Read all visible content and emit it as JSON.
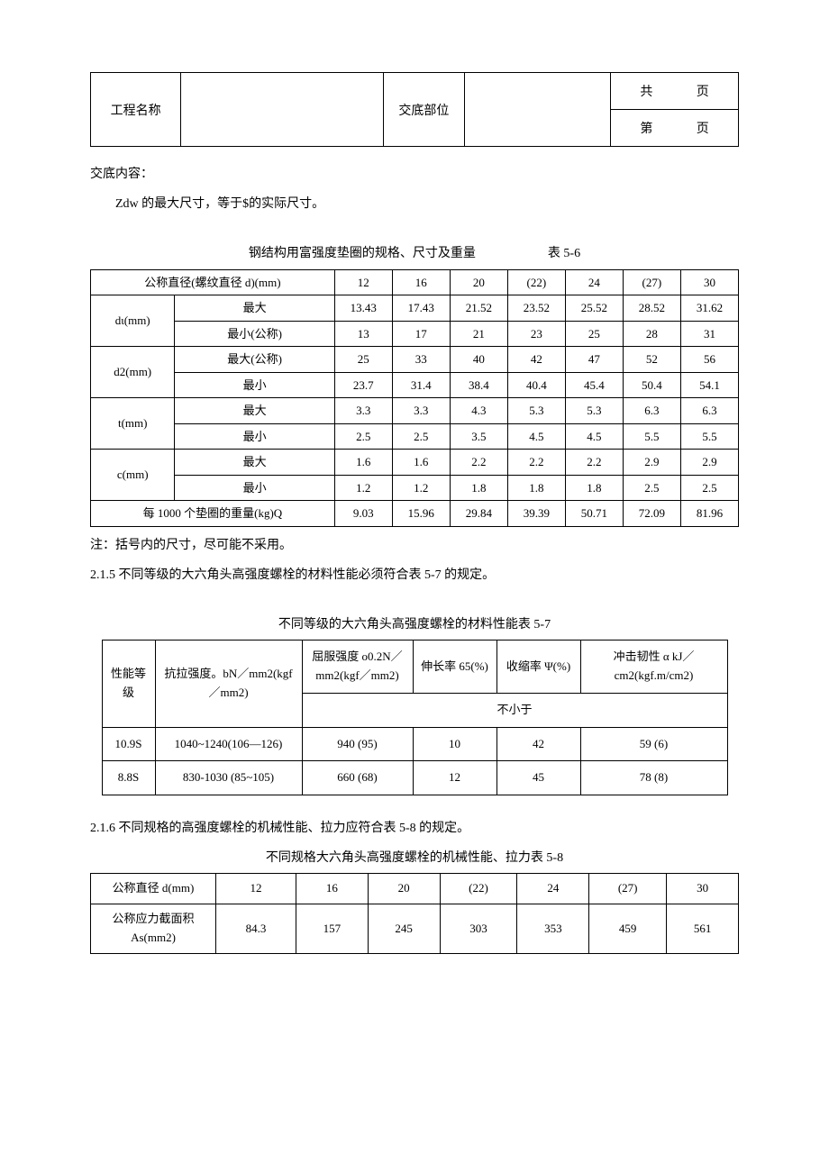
{
  "header": {
    "project_label": "工程名称",
    "part_label": "交底部位",
    "total_lbl_a": "共",
    "total_lbl_b": "页",
    "page_lbl_a": "第",
    "page_lbl_b": "页"
  },
  "content_label": "交底内容：",
  "zdw_line": "Zdw 的最大尺寸，等于$的实际尺寸。",
  "t56_title_left": "钢结构用富强度垫圈的规格、尺寸及重量",
  "t56_title_right": "表 5-6",
  "t56": {
    "h1": "公称直径(螺纹直径 d)(mm)",
    "cols": [
      "12",
      "16",
      "20",
      "(22)",
      "24",
      "(27)",
      "30"
    ],
    "rows": [
      {
        "lab": "dι(mm)",
        "sub1": "最大",
        "v1": [
          "13.43",
          "17.43",
          "21.52",
          "23.52",
          "25.52",
          "28.52",
          "31.62"
        ],
        "sub2": "最小(公称)",
        "v2": [
          "13",
          "17",
          "21",
          "23",
          "25",
          "28",
          "31"
        ]
      },
      {
        "lab": "d2(mm)",
        "sub1": "最大(公称)",
        "v1": [
          "25",
          "33",
          "40",
          "42",
          "47",
          "52",
          "56"
        ],
        "sub2": "最小",
        "v2": [
          "23.7",
          "31.4",
          "38.4",
          "40.4",
          "45.4",
          "50.4",
          "54.1"
        ]
      },
      {
        "lab": "t(mm)",
        "sub1": "最大",
        "v1": [
          "3.3",
          "3.3",
          "4.3",
          "5.3",
          "5.3",
          "6.3",
          "6.3"
        ],
        "sub2": "最小",
        "v2": [
          "2.5",
          "2.5",
          "3.5",
          "4.5",
          "4.5",
          "5.5",
          "5.5"
        ]
      },
      {
        "lab": "c(mm)",
        "sub1": "最大",
        "v1": [
          "1.6",
          "1.6",
          "2.2",
          "2.2",
          "2.2",
          "2.9",
          "2.9"
        ],
        "sub2": "最小",
        "v2": [
          "1.2",
          "1.2",
          "1.8",
          "1.8",
          "1.8",
          "2.5",
          "2.5"
        ]
      }
    ],
    "weight_lab": "每 1000 个垫圈的重量(kg)Q",
    "weight": [
      "9.03",
      "15.96",
      "29.84",
      "39.39",
      "50.71",
      "72.09",
      "81.96"
    ]
  },
  "note_bracket": "注：括号内的尺寸，尽可能不采用。",
  "clause_215": "2.1.5 不同等级的大六角头高强度螺栓的材料性能必须符合表 5-7 的规定。",
  "t57_title": "不同等级的大六角头高强度螺栓的材料性能表 5-7",
  "t57": {
    "h1": "性能等级",
    "h2": "抗拉强度。bN／mm2(kgf／mm2)",
    "h3": "屈服强度 o0.2N／mm2(kgf／mm2)",
    "h4": "伸长率 65(%)",
    "h5": "收缩率 Ψ(%)",
    "h6": "冲击韧性 α kJ／cm2(kgf.m/cm2)",
    "not_less": "不小于",
    "rows": [
      {
        "grade": "10.9S",
        "tensile": "1040~1240(106—126)",
        "yield": "940 (95)",
        "elong": "10",
        "shrink": "42",
        "impact": "59 (6)"
      },
      {
        "grade": "8.8S",
        "tensile": "830-1030 (85~105)",
        "yield": "660 (68)",
        "elong": "12",
        "shrink": "45",
        "impact": "78 (8)"
      }
    ]
  },
  "clause_216": "2.1.6 不同规格的高强度螺栓的机械性能、拉力应符合表 5-8 的规定。",
  "t58_title": "不同规格大六角头高强度螺栓的机械性能、拉力表 5-8",
  "t58": {
    "h1": "公称直径 d(mm)",
    "cols": [
      "12",
      "16",
      "20",
      "(22)",
      "24",
      "(27)",
      "30"
    ],
    "h2": "公称应力截面积 As(mm2)",
    "vals": [
      "84.3",
      "157",
      "245",
      "303",
      "353",
      "459",
      "561"
    ]
  },
  "chart_data": [
    {
      "type": "table",
      "title": "表5-6 钢结构用富强度垫圈的规格、尺寸及重量",
      "columns": [
        "公称直径d(mm)",
        "12",
        "16",
        "20",
        "(22)",
        "24",
        "(27)",
        "30"
      ],
      "rows": [
        [
          "dι 最大",
          "13.43",
          "17.43",
          "21.52",
          "23.52",
          "25.52",
          "28.52",
          "31.62"
        ],
        [
          "dι 最小(公称)",
          "13",
          "17",
          "21",
          "23",
          "25",
          "28",
          "31"
        ],
        [
          "d2 最大(公称)",
          "25",
          "33",
          "40",
          "42",
          "47",
          "52",
          "56"
        ],
        [
          "d2 最小",
          "23.7",
          "31.4",
          "38.4",
          "40.4",
          "45.4",
          "50.4",
          "54.1"
        ],
        [
          "t 最大",
          "3.3",
          "3.3",
          "4.3",
          "5.3",
          "5.3",
          "6.3",
          "6.3"
        ],
        [
          "t 最小",
          "2.5",
          "2.5",
          "3.5",
          "4.5",
          "4.5",
          "5.5",
          "5.5"
        ],
        [
          "c 最大",
          "1.6",
          "1.6",
          "2.2",
          "2.2",
          "2.2",
          "2.9",
          "2.9"
        ],
        [
          "c 最小",
          "1.2",
          "1.2",
          "1.8",
          "1.8",
          "1.8",
          "2.5",
          "2.5"
        ],
        [
          "每1000个垫圈重量(kg)Q",
          "9.03",
          "15.96",
          "29.84",
          "39.39",
          "50.71",
          "72.09",
          "81.96"
        ]
      ]
    },
    {
      "type": "table",
      "title": "表5-7 不同等级的大六角头高强度螺栓的材料性能",
      "columns": [
        "性能等级",
        "抗拉强度 bN/mm2(kgf/mm2)",
        "屈服强度 0.2N/mm2(kgf/mm2)",
        "伸长率65(%)",
        "收缩率Ψ(%)",
        "冲击韧性 kJ/cm2(kgf.m/cm2)"
      ],
      "rows": [
        [
          "10.9S",
          "1040~1240(106-126)",
          "940(95)",
          "10",
          "42",
          "59(6)"
        ],
        [
          "8.8S",
          "830-1030(85~105)",
          "660(68)",
          "12",
          "45",
          "78(8)"
        ]
      ]
    },
    {
      "type": "table",
      "title": "表5-8 不同规格大六角头高强度螺栓的机械性能、拉力",
      "columns": [
        "公称直径d(mm)",
        "12",
        "16",
        "20",
        "(22)",
        "24",
        "(27)",
        "30"
      ],
      "rows": [
        [
          "公称应力截面积As(mm2)",
          "84.3",
          "157",
          "245",
          "303",
          "353",
          "459",
          "561"
        ]
      ]
    }
  ]
}
